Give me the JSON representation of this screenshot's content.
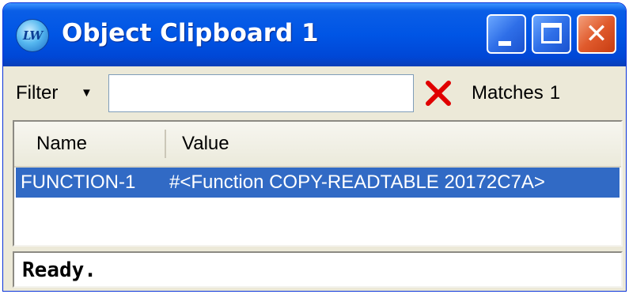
{
  "window": {
    "title": "Object Clipboard 1",
    "app_icon_text": "LW",
    "controls": {
      "minimize_icon": "minimize-icon",
      "maximize_icon": "maximize-icon",
      "close_icon": "close-icon",
      "close_glyph": "✕"
    }
  },
  "filter": {
    "label": "Filter",
    "dropdown_arrow": "▼",
    "input_value": "",
    "clear_icon": "red-x-clear-icon",
    "matches_label": "Matches",
    "matches_count": "1"
  },
  "list": {
    "columns": [
      "Name",
      "Value"
    ],
    "rows": [
      {
        "name": "FUNCTION-1",
        "value": "#<Function COPY-READTABLE 20172C7A>",
        "selected": true
      }
    ]
  },
  "status": {
    "text": "Ready."
  },
  "colors": {
    "selection": "#316ac5",
    "title_blue": "#0055e5",
    "close_red": "#e05a2c",
    "clear_x": "#e00000"
  }
}
